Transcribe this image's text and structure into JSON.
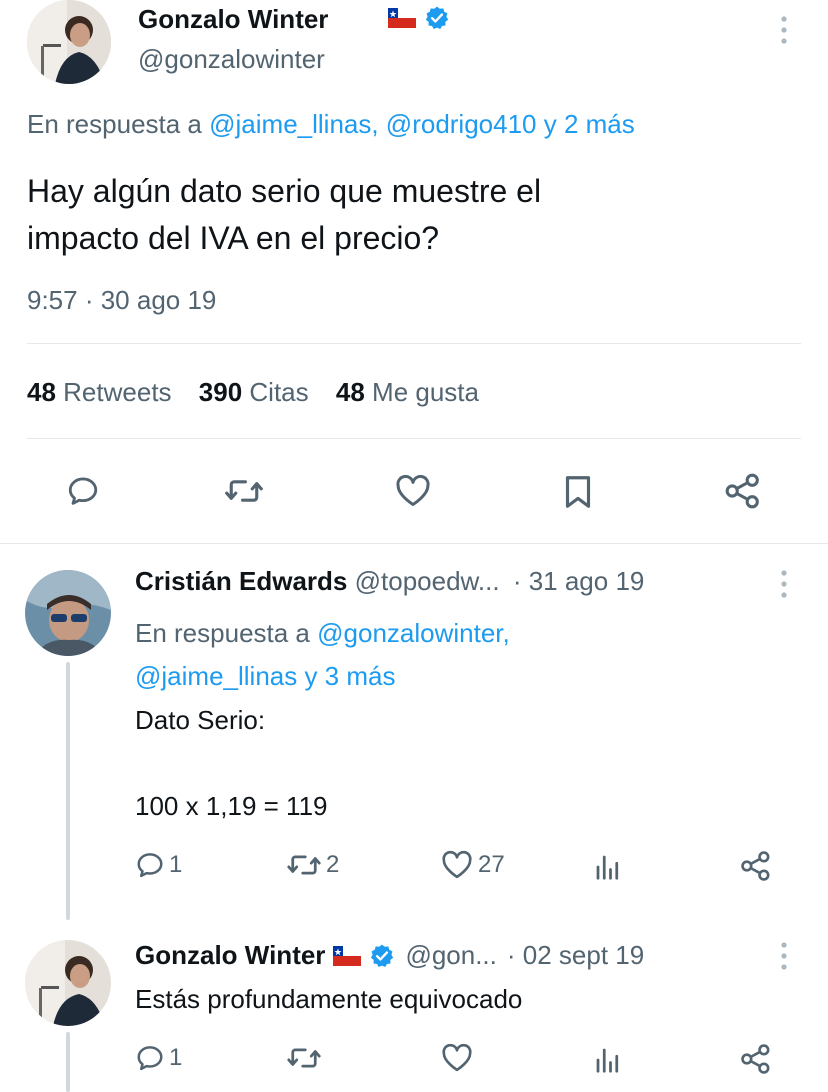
{
  "main_tweet": {
    "author_name": "Gonzalo Winter",
    "author_handle": "@gonzalowinter",
    "reply_prefix": "En respuesta a",
    "reply_mentions": "@jaime_llinas, @rodrigo410 y 2 más",
    "text_line1": "Hay algún dato serio que muestre el",
    "text_line2": "impacto del IVA en el precio?",
    "timestamp": "9:57 · 30 ago 19",
    "stats": {
      "retweets_count": "48",
      "retweets_label": "Retweets",
      "quotes_count": "390",
      "quotes_label": "Citas",
      "likes_count": "48",
      "likes_label": "Me gusta"
    }
  },
  "reply_1": {
    "author_name": "Cristián Edwards",
    "author_handle": "@topoedw...",
    "date": "· 31 ago 19",
    "reply_prefix": "En respuesta a",
    "reply_mention_1": "@gonzalowinter,",
    "reply_mention_2": "@jaime_llinas y 3 más",
    "text_line1": "Dato Serio:",
    "text_line2": "100 x 1,19 = 119",
    "reply_count": "1",
    "retweet_count": "2",
    "like_count": "27"
  },
  "reply_2": {
    "author_name": "Gonzalo Winter",
    "author_handle": "@gon...",
    "date": "· 02 sept 19",
    "text": "Estás profundamente equivocado",
    "reply_count": "1"
  },
  "colors": {
    "link": "#1d9bf0",
    "muted": "#536471",
    "verified": "#1d9bf0",
    "text": "#0f1419"
  },
  "icons": {
    "more": "more-vertical-icon",
    "verified": "verified-badge-icon",
    "flag": "chile-flag-icon",
    "reply": "reply-icon",
    "retweet": "retweet-icon",
    "like": "heart-icon",
    "bookmark": "bookmark-icon",
    "share": "share-icon",
    "views": "views-icon"
  }
}
